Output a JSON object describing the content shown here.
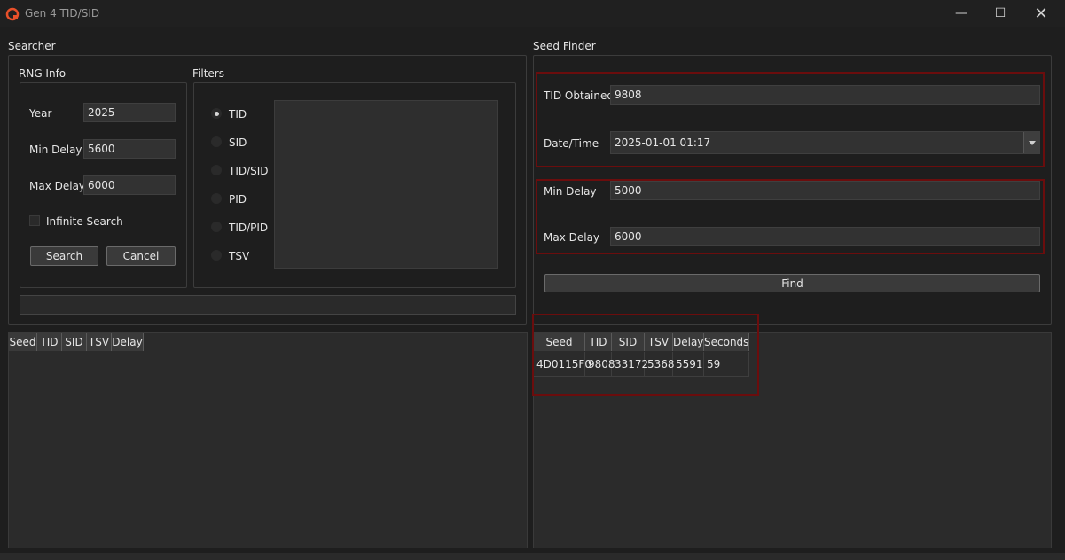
{
  "window": {
    "title": "Gen 4 TID/SID"
  },
  "searcher": {
    "title": "Searcher",
    "rng_info": {
      "title": "RNG Info",
      "year_label": "Year",
      "year_value": "2025",
      "min_delay_label": "Min Delay",
      "min_delay_value": "5600",
      "max_delay_label": "Max Delay",
      "max_delay_value": "6000",
      "infinite_label": "Infinite Search",
      "search_label": "Search",
      "cancel_label": "Cancel"
    },
    "filters": {
      "title": "Filters",
      "options": [
        "TID",
        "SID",
        "TID/SID",
        "PID",
        "TID/PID",
        "TSV"
      ],
      "selected": "TID"
    },
    "results": {
      "columns": [
        "Seed",
        "TID",
        "SID",
        "TSV",
        "Delay"
      ]
    }
  },
  "seed_finder": {
    "title": "Seed Finder",
    "tid_label": "TID Obtained",
    "tid_value": "9808",
    "datetime_label": "Date/Time",
    "datetime_value": "2025-01-01 01:17",
    "min_delay_label": "Min Delay",
    "min_delay_value": "5000",
    "max_delay_label": "Max Delay",
    "max_delay_value": "6000",
    "find_label": "Find",
    "results": {
      "columns": [
        "Seed",
        "TID",
        "SID",
        "TSV",
        "Delay",
        "Seconds"
      ],
      "rows": [
        [
          "4D0115F0",
          "9808",
          "33172",
          "5368",
          "5591",
          "59"
        ]
      ]
    }
  },
  "colors": {
    "highlight": "#6b0d0d",
    "accent_icon": "#e8502a"
  }
}
